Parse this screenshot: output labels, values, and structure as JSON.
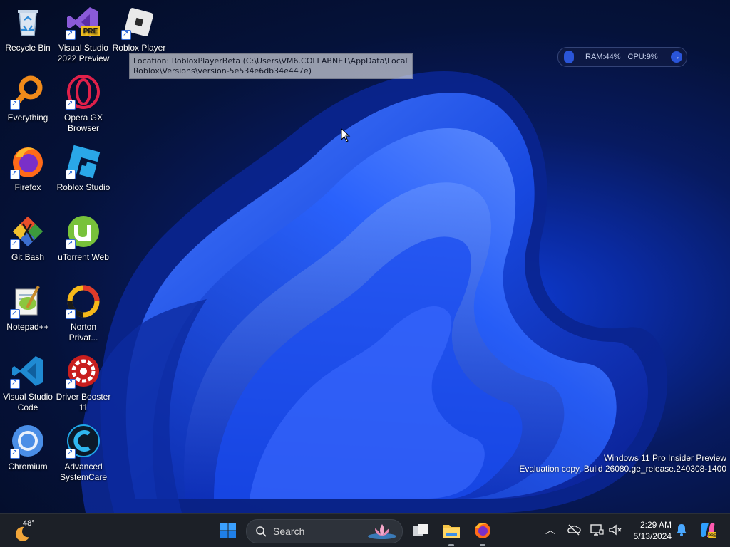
{
  "desktop": {
    "icons": [
      {
        "label": "Recycle Bin",
        "icon": "recycle-bin-icon"
      },
      {
        "label": "Visual Studio 2022 Preview",
        "icon": "visual-studio-preview-icon",
        "badge": "PRE"
      },
      {
        "label": "Roblox Player",
        "icon": "roblox-player-icon"
      },
      {
        "label": "Everything",
        "icon": "everything-search-icon"
      },
      {
        "label": "Opera GX Browser",
        "icon": "opera-gx-icon"
      },
      {
        "label": "Firefox",
        "icon": "firefox-icon"
      },
      {
        "label": "Roblox Studio",
        "icon": "roblox-studio-icon"
      },
      {
        "label": "Git Bash",
        "icon": "git-bash-icon"
      },
      {
        "label": "uTorrent Web",
        "icon": "utorrent-icon"
      },
      {
        "label": "Notepad++",
        "icon": "notepad-plus-plus-icon"
      },
      {
        "label": "Norton Privat...",
        "icon": "norton-private-browser-icon"
      },
      {
        "label": "Visual Studio Code",
        "icon": "vscode-icon"
      },
      {
        "label": "Driver Booster 11",
        "icon": "driver-booster-icon"
      },
      {
        "label": "Chromium",
        "icon": "chromium-icon"
      },
      {
        "label": "Advanced SystemCare",
        "icon": "advanced-systemcare-icon"
      }
    ],
    "tooltip": {
      "line1": "Location: RobloxPlayerBeta (C:\\Users\\VM6.COLLABNET\\AppData\\Local\\",
      "line2": "Roblox\\Versions\\version-5e534e6db34e447e)"
    },
    "widget": {
      "ram": "RAM:44%",
      "cpu": "CPU:9%"
    },
    "watermark": {
      "line1": "Windows 11 Pro Insider Preview",
      "line2": "Evaluation copy. Build 26080.ge_release.240308-1400"
    }
  },
  "taskbar": {
    "weather": {
      "temp": "48°",
      "icon": "moon-icon"
    },
    "search_placeholder": "Search",
    "clock": {
      "time": "2:29 AM",
      "date": "5/13/2024"
    },
    "tray_icons": [
      "chevron-up-icon",
      "onedrive-paused-icon",
      "network-icon",
      "volume-muted-icon",
      "notification-bell-icon",
      "copilot-icon"
    ]
  },
  "colors": {
    "accent": "#1f6fff",
    "taskbar": "#1c2027"
  }
}
